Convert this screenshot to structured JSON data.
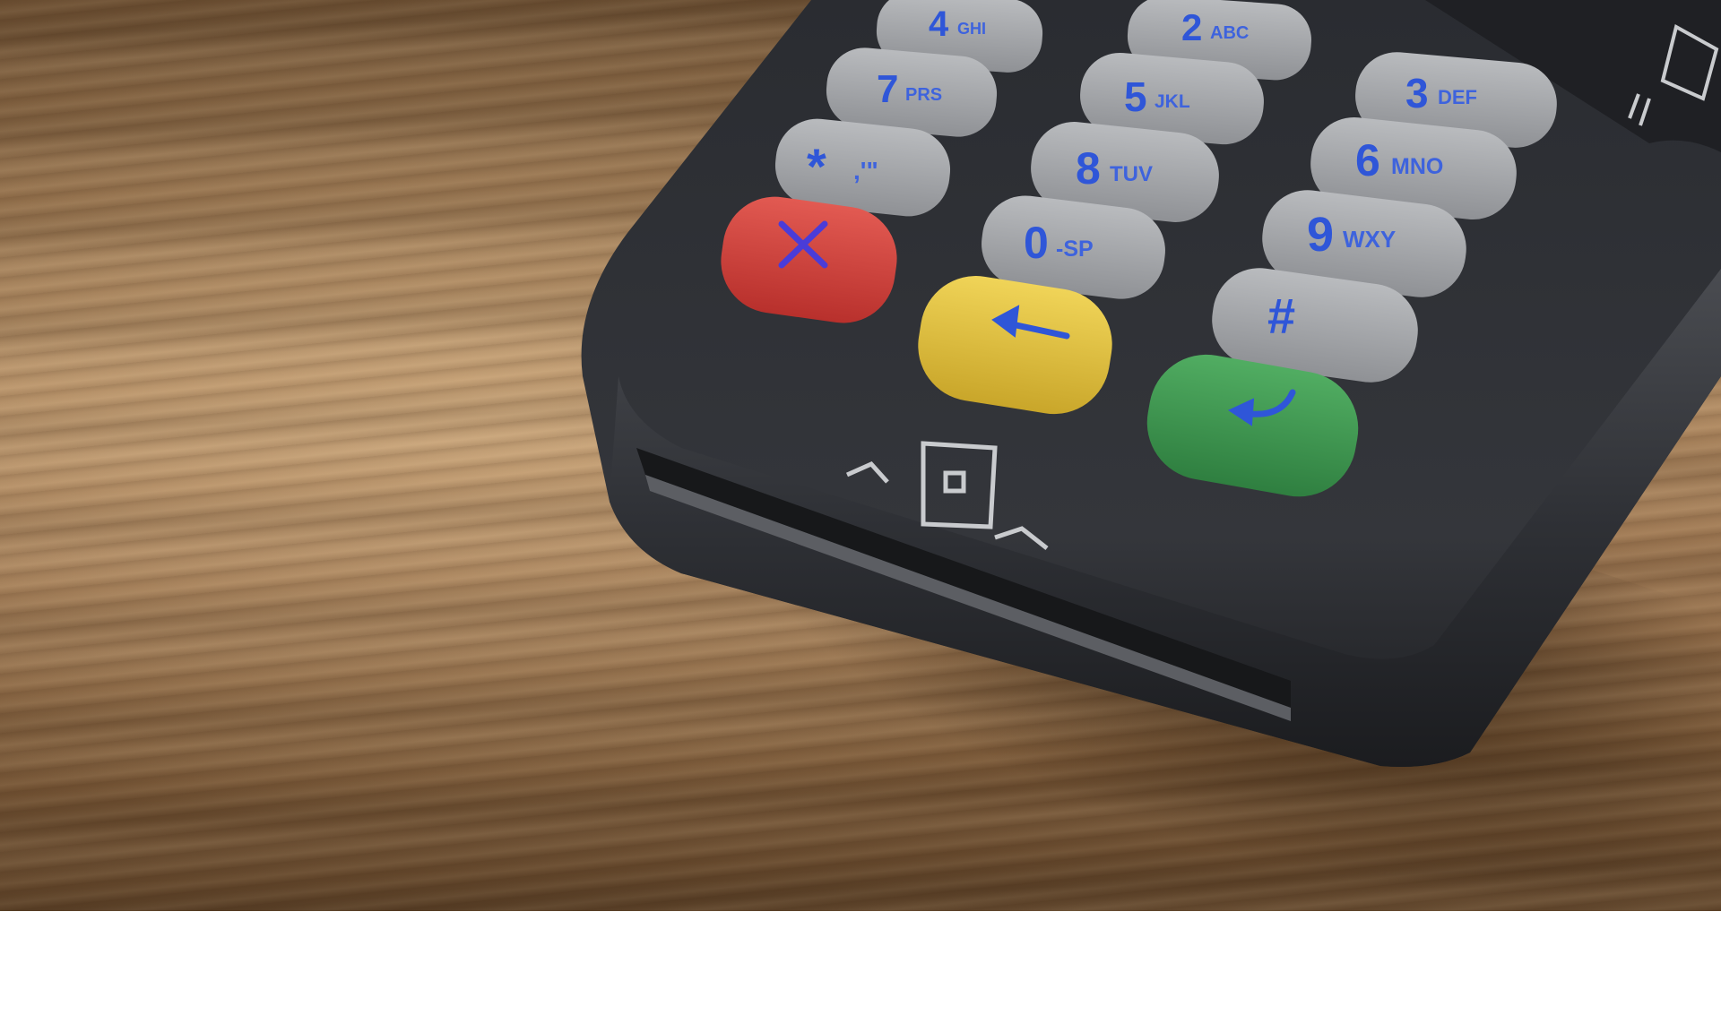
{
  "scene": {
    "subject": "card payment terminal keypad",
    "colors": {
      "wood": "#9c7650",
      "device_body": "#2b2d31",
      "key_grey": "#a9abae",
      "key_text": "#2f56d8",
      "cancel_red": "#d2413c",
      "clear_yellow": "#e2c23c",
      "enter_green": "#3f9a52",
      "emblem": "#c9cbce"
    }
  },
  "keys": {
    "k1": {
      "digit": "4",
      "letters": "GHI"
    },
    "k2": {
      "digit": "2",
      "letters": "ABC"
    },
    "k3": {
      "digit": "7",
      "letters": "PRS"
    },
    "k4": {
      "digit": "5",
      "letters": "JKL"
    },
    "k5": {
      "digit": "3",
      "letters": "DEF"
    },
    "k6": {
      "digit": "*",
      "letters": ",'\""
    },
    "k7": {
      "digit": "8",
      "letters": "TUV"
    },
    "k8": {
      "digit": "6",
      "letters": "MNO"
    },
    "k9": {
      "digit": "0",
      "letters": "-SP"
    },
    "k10": {
      "digit": "9",
      "letters": "WXY"
    },
    "k11": {
      "digit": "#",
      "letters": ""
    }
  },
  "function_keys": {
    "cancel_icon": "x-icon",
    "clear_icon": "arrow-left-icon",
    "enter_icon": "enter-arrow-icon"
  },
  "card_slot_icon": "card-insert-icon"
}
